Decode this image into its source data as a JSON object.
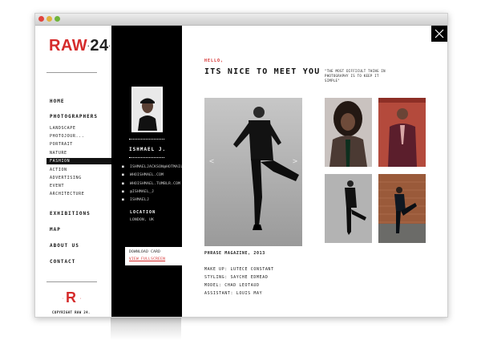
{
  "brand": {
    "logo_text": "RAW",
    "logo_number": "24",
    "footer_monogram": "R",
    "copyright": "COPYRIGHT RAW 24.",
    "accent_color": "#d52b2b"
  },
  "nav": {
    "home": "HOME",
    "photographers": "PHOTOGRAPHERS",
    "categories": [
      "LANDSCAPE",
      "PHOTOJOUR...",
      "PORTRAIT",
      "NATURE",
      "FASHION",
      "ACTION",
      "ADVERTISING",
      "EVENT",
      "ARCHITECTURE"
    ],
    "active_category": "FASHION",
    "exhibitions": "EXHIBITIONS",
    "map": "MAP",
    "about": "ABOUT US",
    "contact": "CONTACT"
  },
  "profile": {
    "name": "ISHMAEL J.",
    "contacts": [
      "ISHMAELJACKSON@HOTMAIL.CO.UK",
      "WHOISHMAEL.COM",
      "WHOISHMAEL.TUMBLR.COM",
      "@ISHMAEL_J",
      "ISHMAELJ"
    ],
    "location_label": "LOCATION",
    "location_value": "LONDON, UK",
    "download_label": "DOWNLOAD CARD",
    "follow_label": "VIEW FULLSCREEN"
  },
  "main": {
    "greeting": "HELLO,",
    "headline": "ITS NICE TO MEET YOU",
    "quote": "\"THE MOST DIFFICULT THING IN PHOTOGRAPHY IS TO KEEP IT SIMPLE\"",
    "prev_arrow": "<",
    "next_arrow": ">",
    "publication": "PHRASE MAGAZINE, 2013",
    "credits": [
      "MAKE UP: LUTECE CONSTANT",
      "STYLING: SAYCHE EDMEAD",
      "MODEL: CHAD LEOTAUD",
      "ASSISTANT: LOUIS MAY"
    ]
  },
  "icons": {
    "close": "close-icon",
    "bullet": "bullet-icon"
  }
}
